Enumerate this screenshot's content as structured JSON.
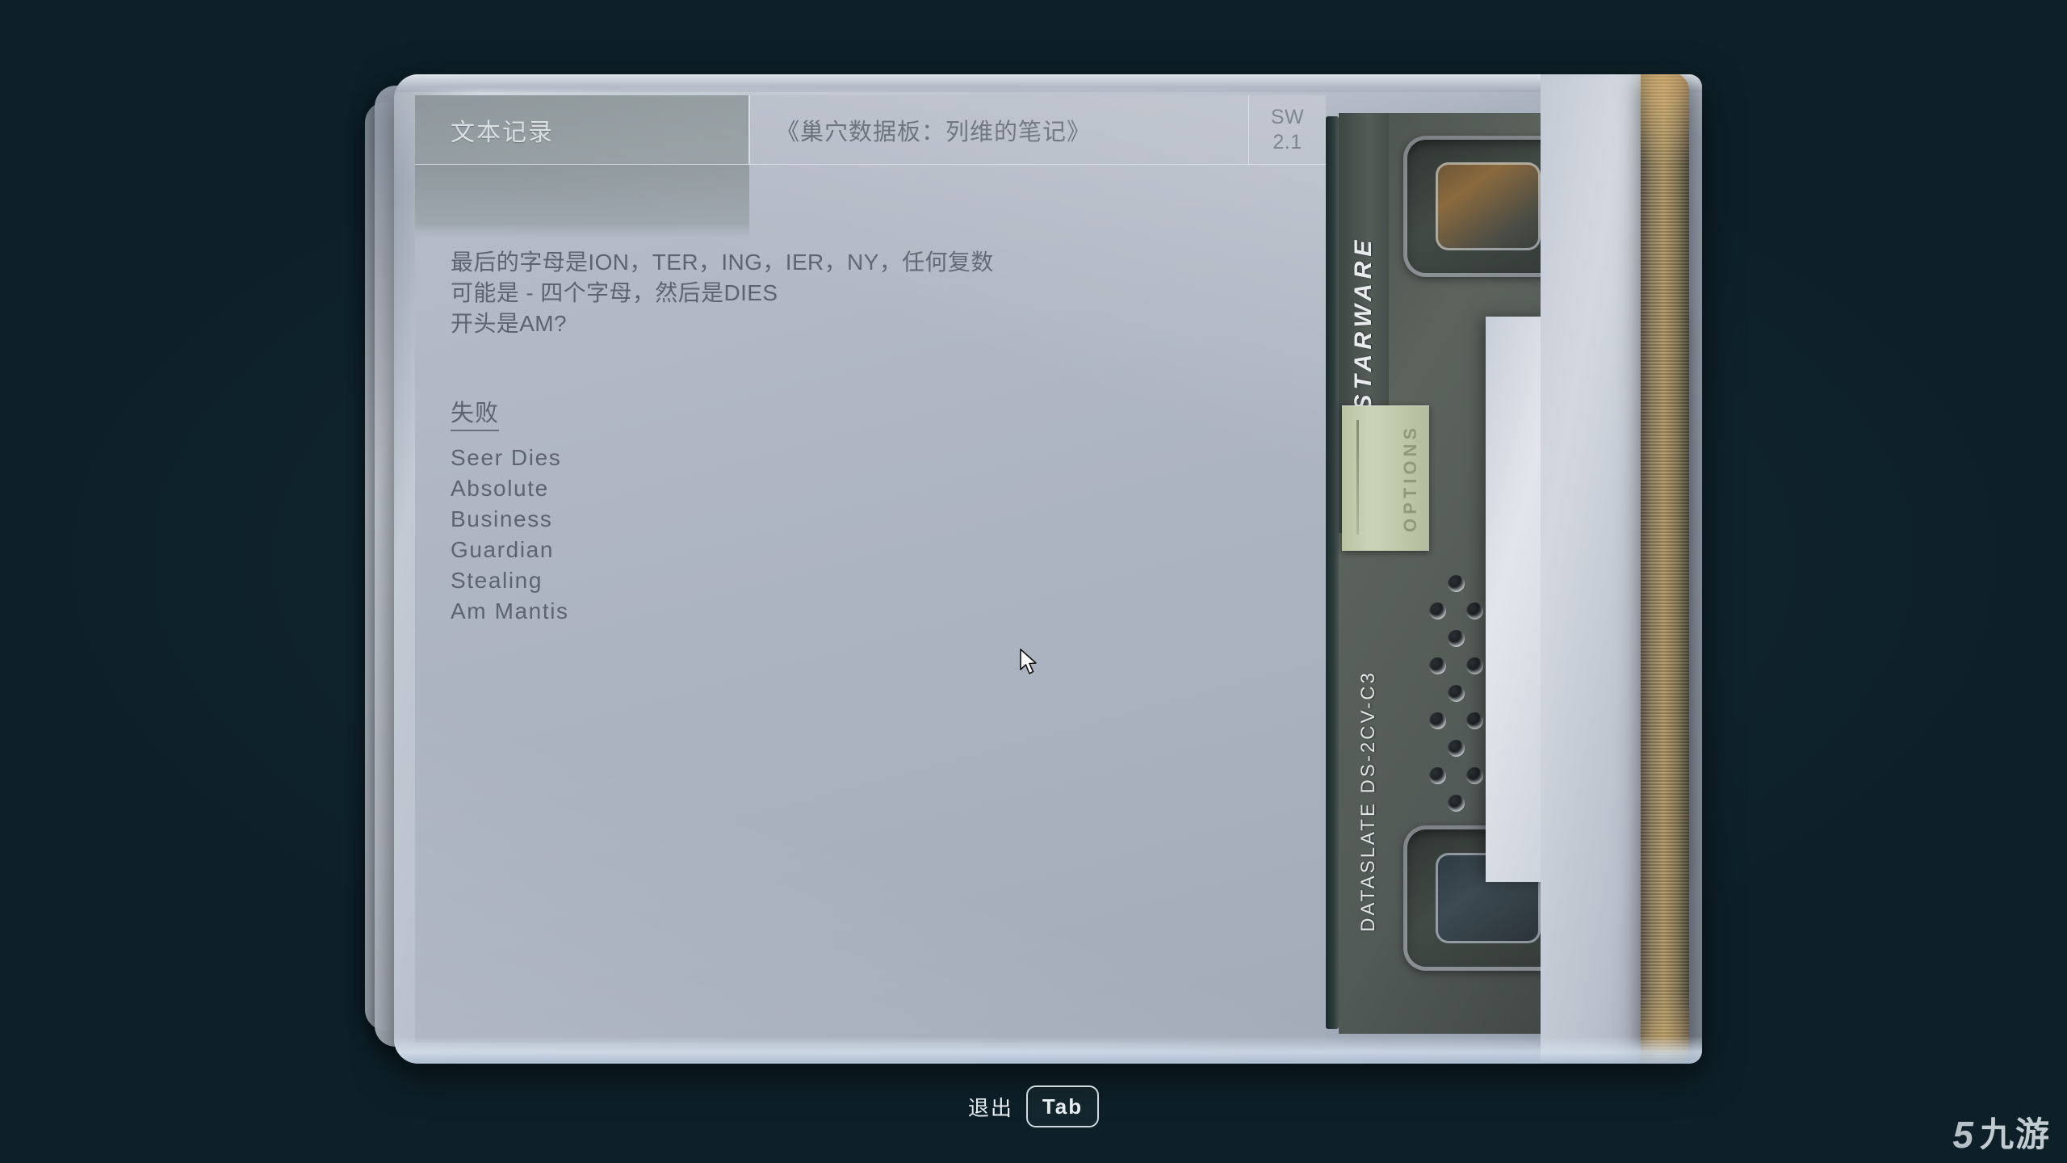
{
  "background_color": "#0d2028",
  "device": {
    "brand": "STARWARE",
    "model_label": "DATASLATE  DS-2CV-C3",
    "options_button_label": "OPTIONS",
    "screen": {
      "tab_label": "文本记录",
      "document_title": "《巢穴数据板：列维的笔记》",
      "version_line1": "SW",
      "version_line2": "2.1",
      "body_lines": [
        "最后的字母是ION，TER，ING，IER，NY，任何复数",
        "可能是 - 四个字母，然后是DIES",
        "开头是AM?"
      ],
      "section_heading": "失败",
      "section_items": [
        "Seer Dies",
        "Absolute",
        "Business",
        "Guardian",
        "Stealing",
        "Am Mantis"
      ]
    }
  },
  "footer": {
    "exit_label": "退出",
    "exit_key": "Tab"
  },
  "watermark": {
    "mark": "5",
    "text": "九游"
  }
}
